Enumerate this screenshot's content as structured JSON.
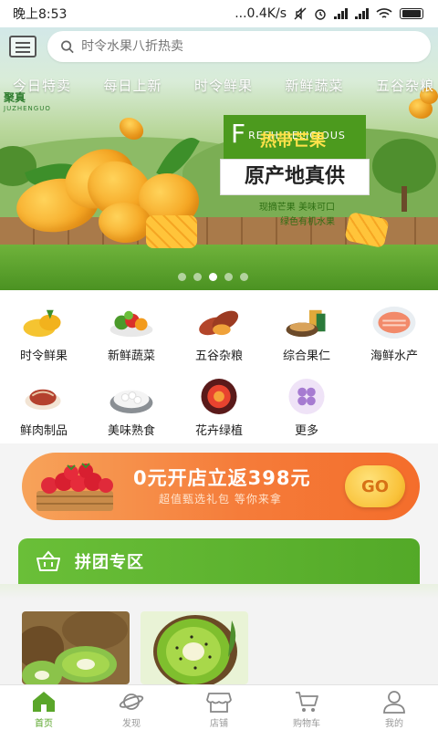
{
  "status_bar": {
    "time": "晚上8:53",
    "network_speed": "...0.4K/s"
  },
  "search": {
    "placeholder": "时令水果八折热卖"
  },
  "category_tabs": [
    "今日特卖",
    "每日上新",
    "时令鲜果",
    "新鲜蔬菜",
    "五谷杂粮"
  ],
  "logo": {
    "text_cn": "聚真",
    "text_en": "JUZHENGUO"
  },
  "hero": {
    "en_initial": "F",
    "en_text": "RESH DELICIOUS",
    "title": "热带芒果",
    "subtitle": "原产地真供",
    "note_line1": "现摘芒果  美味可口",
    "note_line2": "绿色有机水果",
    "slides": 5,
    "active_slide": 3
  },
  "categories": [
    {
      "label": "时令鲜果",
      "icon": "fruit-icon"
    },
    {
      "label": "新鲜蔬菜",
      "icon": "vegetable-icon"
    },
    {
      "label": "五谷杂粮",
      "icon": "grain-icon"
    },
    {
      "label": "综合果仁",
      "icon": "nuts-icon"
    },
    {
      "label": "海鲜水产",
      "icon": "seafood-icon"
    },
    {
      "label": "鲜肉制品",
      "icon": "meat-icon"
    },
    {
      "label": "美味熟食",
      "icon": "cooked-food-icon"
    },
    {
      "label": "花卉绿植",
      "icon": "flower-icon"
    },
    {
      "label": "更多",
      "icon": "more-icon"
    }
  ],
  "ad": {
    "title": "0元开店立返398元",
    "subtitle": "超值甄选礼包  等你来拿",
    "button": "GO"
  },
  "group_section": {
    "title": "拼团专区"
  },
  "tabbar": [
    {
      "label": "首页",
      "icon": "home-icon",
      "active": true
    },
    {
      "label": "发现",
      "icon": "planet-icon",
      "active": false
    },
    {
      "label": "店铺",
      "icon": "store-icon",
      "active": false
    },
    {
      "label": "购物车",
      "icon": "cart-icon",
      "active": false
    },
    {
      "label": "我的",
      "icon": "user-icon",
      "active": false
    }
  ],
  "colors": {
    "brand_green": "#5aa62a",
    "ad_orange": "#f57c3a"
  }
}
